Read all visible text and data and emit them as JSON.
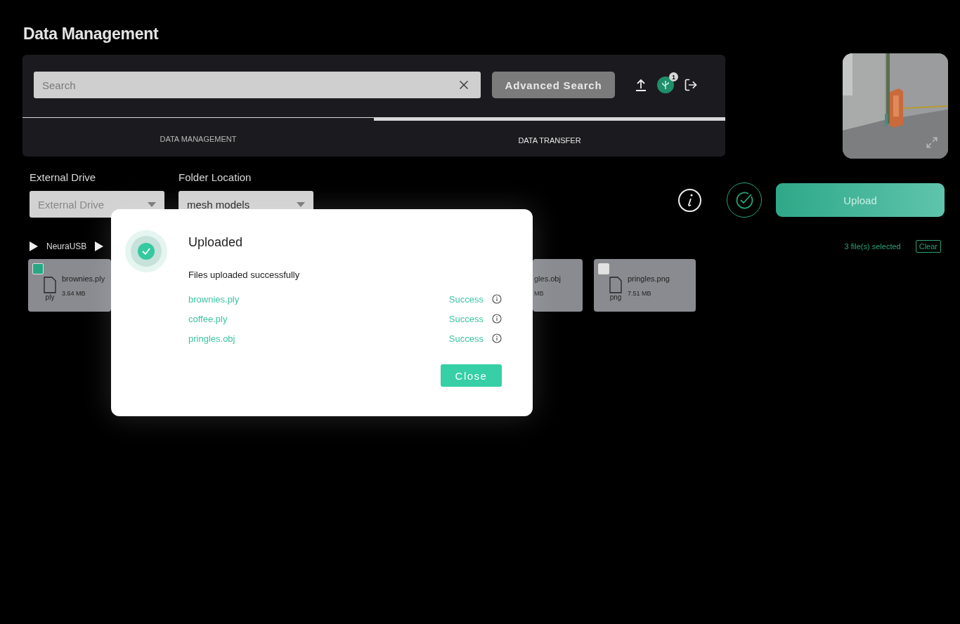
{
  "page_title": "Data Management",
  "search": {
    "placeholder": "Search"
  },
  "advanced_search": "Advanced Search",
  "transfer_badge": "1",
  "tabs": [
    {
      "label": "DATA MANAGEMENT",
      "selected": false
    },
    {
      "label": "DATA TRANSFER",
      "selected": true
    }
  ],
  "filters": [
    {
      "label": "External Drive",
      "placeholder": "External Drive"
    },
    {
      "label": "Folder Location",
      "value": "mesh models"
    }
  ],
  "upload_button": "Upload",
  "breadcrumb": [
    {
      "label": "NeuraUSB"
    }
  ],
  "selection": {
    "count": "3 file(s) selected",
    "clear": "Clear"
  },
  "files": [
    {
      "kind": "card",
      "name": "brownies.ply",
      "size": "3.64 MB",
      "ext": "ply",
      "checked": true
    },
    {
      "kind": "partial",
      "name": "gles.obj",
      "size": "MB"
    },
    {
      "kind": "card",
      "name": "pringles.png",
      "size": "7.51 MB",
      "ext": "png",
      "checked": false
    }
  ],
  "dialog": {
    "title": "Uploaded",
    "message": "Files uploaded successfully",
    "results": [
      {
        "file": "brownies.ply",
        "status": "Success"
      },
      {
        "file": "coffee.ply",
        "status": "Success"
      },
      {
        "file": "pringles.obj",
        "status": "Success"
      }
    ],
    "close": "Close"
  }
}
